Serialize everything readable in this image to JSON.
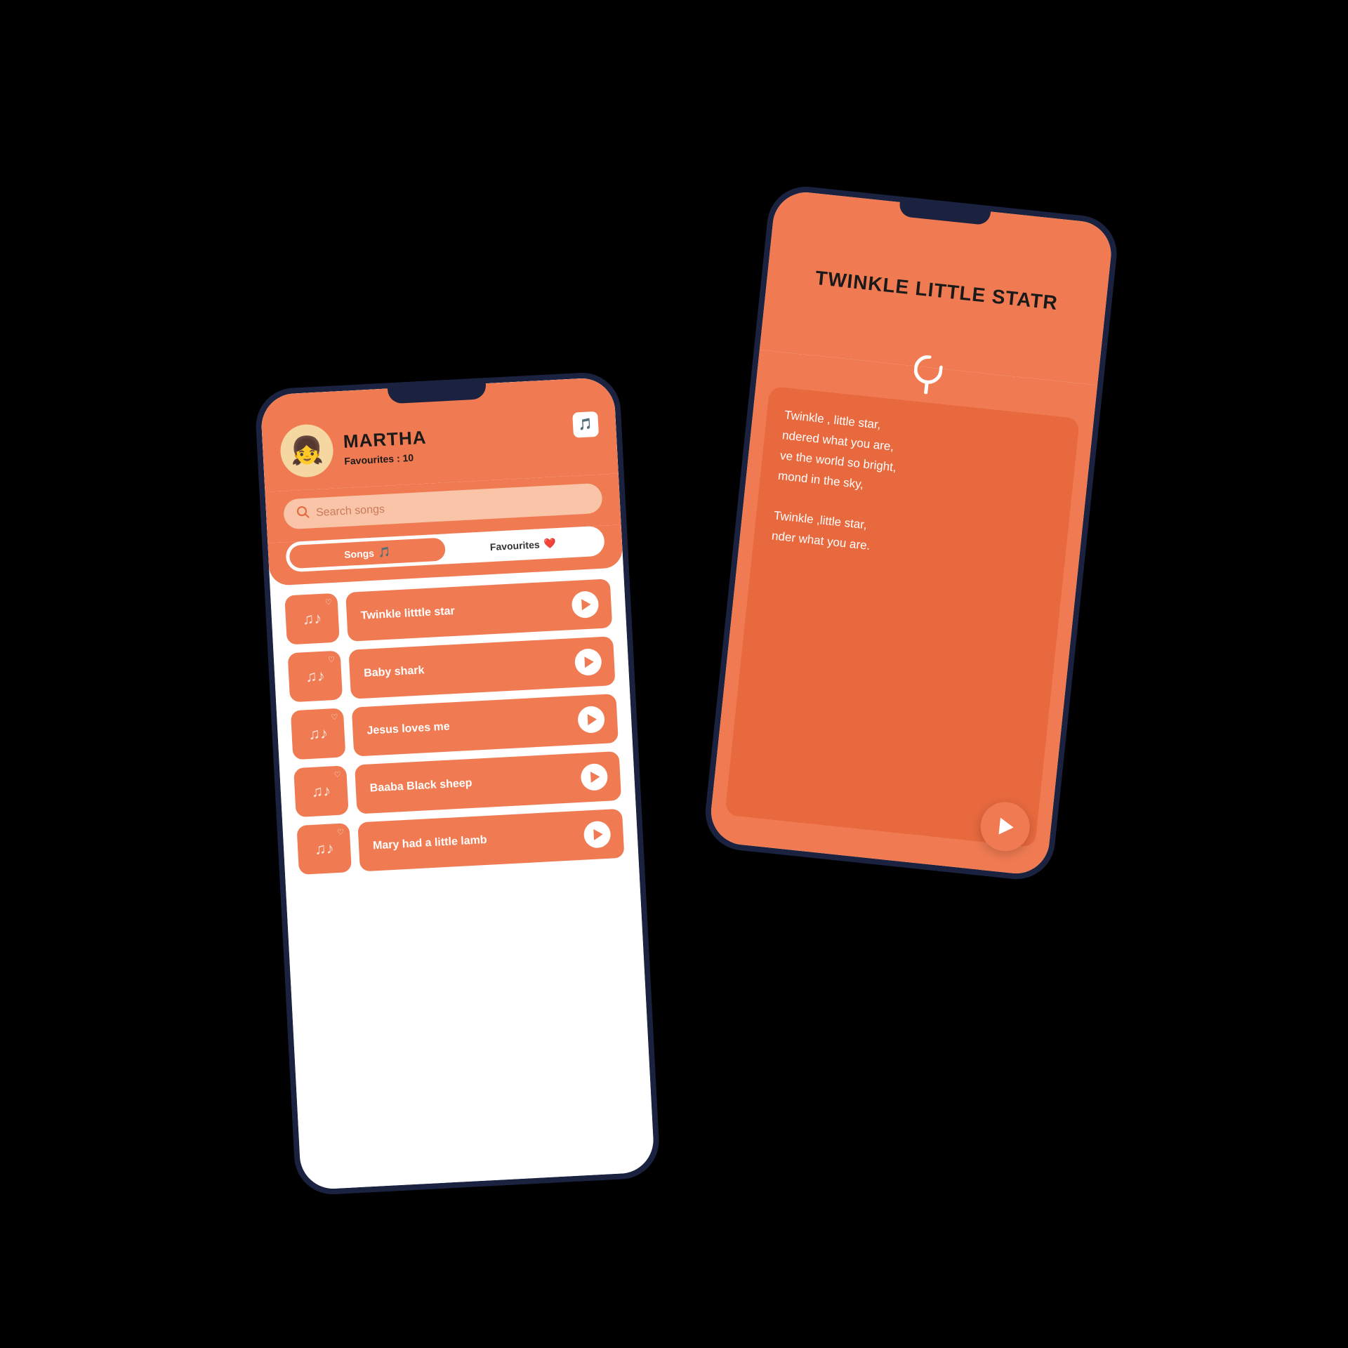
{
  "back_phone": {
    "title": "TWINKLE LITTLE STATR",
    "lyrics_lines": [
      "Twinkle , little star,",
      "ndered what you are,",
      "ve the world so bright,",
      "mond in the sky,",
      "",
      "Twinkle ,little star,",
      "nder what you are."
    ],
    "lyrics_full": "Twinkle , little star,\nndered what you are,\nve the world so bright,\nmond in the sky,\n\nTwinkle ,little star,\nnder what you are."
  },
  "front_phone": {
    "user_name": "MARTHA",
    "favourites_label": "Favourites : 10",
    "search_placeholder": "Search songs",
    "tabs": [
      {
        "label": "Songs",
        "icon": "🎵",
        "active": true
      },
      {
        "label": "Favourites",
        "icon": "❤️",
        "active": false
      }
    ],
    "songs": [
      {
        "title": "Twinkle litttle star"
      },
      {
        "title": "Baby shark"
      },
      {
        "title": "Jesus loves me"
      },
      {
        "title": "Baaba Black sheep"
      },
      {
        "title": "Mary had a little lamb"
      }
    ]
  },
  "colors": {
    "orange": "#f07b52",
    "dark_orange": "#e8693e",
    "phone_body": "#1a2240",
    "white": "#ffffff"
  }
}
